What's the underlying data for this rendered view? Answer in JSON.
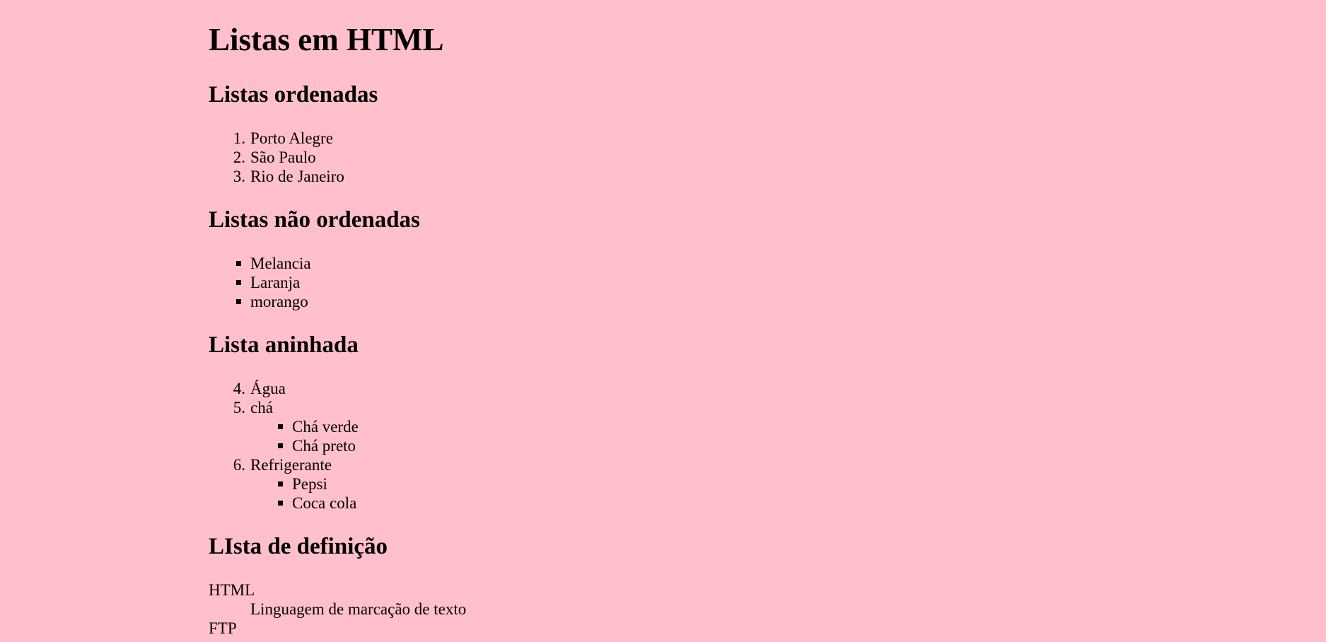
{
  "page": {
    "title": "Listas em HTML",
    "background": "#ffbfcb"
  },
  "ordered": {
    "heading": "Listas ordenadas",
    "items": [
      {
        "marker": "1.",
        "label": "Porto Alegre"
      },
      {
        "marker": "2.",
        "label": "São Paulo"
      },
      {
        "marker": "3.",
        "label": "Rio de Janeiro"
      }
    ]
  },
  "unordered": {
    "heading": "Listas não ordenadas",
    "items": [
      {
        "label": "Melancia"
      },
      {
        "label": "Laranja"
      },
      {
        "label": "morango"
      }
    ]
  },
  "nested": {
    "heading": "Lista aninhada",
    "items": [
      {
        "marker": "4.",
        "label": "Água",
        "children": []
      },
      {
        "marker": "5.",
        "label": "chá",
        "children": [
          {
            "label": "Chá verde"
          },
          {
            "label": "Chá preto"
          }
        ]
      },
      {
        "marker": "6.",
        "label": "Refrigerante",
        "children": [
          {
            "label": "Pepsi"
          },
          {
            "label": "Coca cola"
          }
        ]
      }
    ]
  },
  "definition": {
    "heading": "LIsta de definição",
    "terms": [
      {
        "term": "HTML",
        "definition": "Linguagem de marcação de texto"
      },
      {
        "term": "FTP"
      }
    ]
  }
}
